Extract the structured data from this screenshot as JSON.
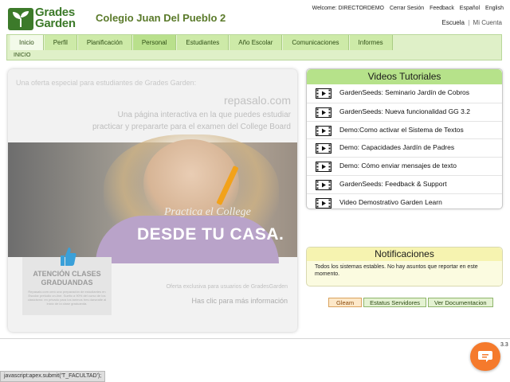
{
  "logo": {
    "line1": "Grades",
    "line2": "Garden"
  },
  "school_name": "Colegio Juan Del Pueblo 2",
  "topbar": {
    "welcome": "Welcome: DIRECTORDEMO",
    "logout": "Cerrar Sesión",
    "feedback": "Feedback",
    "lang_es": "Español",
    "lang_en": "English"
  },
  "sublinks": {
    "school": "Escuela",
    "separator": "|",
    "account": "Mi Cuenta"
  },
  "nav": {
    "tabs": [
      "Inicio",
      "Perfil",
      "Planificación",
      "Personal",
      "Estudiantes",
      "Año Escolar",
      "Comunicaciones",
      "Informes"
    ],
    "breadcrumb": "INICIO"
  },
  "banner": {
    "top_text": "Una oferta especial para estudiantes de Grades Garden:",
    "brand": "repasalo.com",
    "desc_line1": "Una página interactiva en la que puedes estudiar",
    "desc_line2": "practicar y prepararte para el examen del College Board",
    "practica": "Practica el College",
    "desde": "DESDE TU CASA.",
    "attention_title_1": "ATENCIÓN CLASES",
    "attention_title_2": "GRADUANDAS",
    "attention_body": "Repasalo.com creó una preparación de estudiantes en Escolar preludio on-line. Suelto a 90% del curso de los clasicismo: en privado para los tarimos tres darsealte al inicio de la clase graduanda.",
    "oferta": "Oferta exclusiva para usuarios de GradesGarden",
    "click": "Has clic para más información"
  },
  "videos": {
    "title": "Videos Tutoriales",
    "items": [
      "GardenSeeds: Seminario Jardín de Cobros",
      "GardenSeeds: Nueva funcionalidad GG 3.2",
      "Demo:Como activar el Sistema de Textos",
      "Demo: Capacidades Jardín de Padres",
      "Demo: Cómo enviar mensajes de texto",
      "GardenSeeds: Feedback & Support",
      "Video Demostrativo Garden Learn"
    ]
  },
  "notifications": {
    "title": "Notificaciones",
    "body": "Todos los sistemas estables. No hay asuntos que reportar en este momento."
  },
  "buttons": {
    "gleam": "Gleam",
    "status": "Estatus Servidores",
    "docs": "Ver Documentacion"
  },
  "version": "3.3",
  "status_bar": "javascript:apex.submit('T_FACULTAD');",
  "colors": {
    "brand_green": "#3c7a2a",
    "nav_green": "#cdeaa8",
    "accent_orange": "#f57a2c"
  }
}
